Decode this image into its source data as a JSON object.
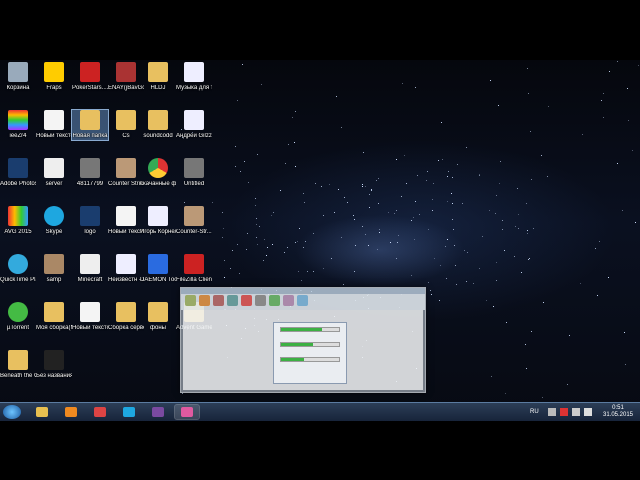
{
  "desktop": {
    "icons": [
      {
        "label": "Корзина",
        "icon": "recycle-bin-icon"
      },
      {
        "label": "Fraps",
        "icon": "fraps-icon"
      },
      {
        "label": "PokerStars....",
        "icon": "pokerstars-icon"
      },
      {
        "label": "ENAY(jBavGc",
        "icon": "archive-icon"
      },
      {
        "label": "HLDJ",
        "icon": "folder-icon"
      },
      {
        "label": "Музыка для тубр - Тру...",
        "icon": "audio-file-icon"
      },
      {
        "label": "ieeZr4",
        "icon": "rainbow-image-icon"
      },
      {
        "label": "Новый текстовый ...",
        "icon": "text-file-icon"
      },
      {
        "label": "Новая папка",
        "icon": "folder-icon"
      },
      {
        "label": "Cs",
        "icon": "folder-icon"
      },
      {
        "label": "soundcodd",
        "icon": "folder-icon"
      },
      {
        "label": "Андрей Gilzz-Lee ...",
        "icon": "audio-file-icon"
      },
      {
        "label": "Adobe Photosh...",
        "icon": "photoshop-icon"
      },
      {
        "label": "server",
        "icon": "file-icon"
      },
      {
        "label": "48117799",
        "icon": "image-file-icon"
      },
      {
        "label": "Counter Strike Sour...",
        "icon": "counter-strike-icon"
      },
      {
        "label": "скачанные файлы",
        "icon": "chrome-icon"
      },
      {
        "label": "Untitled",
        "icon": "image-file-icon"
      },
      {
        "label": "AVG 2015",
        "icon": "avg-icon"
      },
      {
        "label": "Skype",
        "icon": "skype-icon"
      },
      {
        "label": "logo",
        "icon": "photoshop-file-icon"
      },
      {
        "label": "Новый текстов...",
        "icon": "text-file-icon"
      },
      {
        "label": "Игорь Корнелю...",
        "icon": "audio-file-icon"
      },
      {
        "label": "Counter-Str... 1.6 Хром 1...",
        "icon": "counter-strike-icon"
      },
      {
        "label": "QuickTime Player",
        "icon": "quicktime-icon"
      },
      {
        "label": "samp",
        "icon": "gta-icon"
      },
      {
        "label": "Minecraft",
        "icon": "file-icon"
      },
      {
        "label": "Неизвестн - Взрыв это...",
        "icon": "audio-file-icon"
      },
      {
        "label": "DAEMON Tools Lite",
        "icon": "daemon-tools-icon"
      },
      {
        "label": "FileZilla Client",
        "icon": "filezilla-icon"
      },
      {
        "label": "µTorrent",
        "icon": "utorrent-icon"
      },
      {
        "label": "Моя сборка(Ml...",
        "icon": "folder-icon"
      },
      {
        "label": "Новый текстовый ...",
        "icon": "text-file-icon"
      },
      {
        "label": "Сборка сервер...",
        "icon": "folder-icon"
      },
      {
        "label": "фоны",
        "icon": "folder-icon"
      },
      {
        "label": "Advent Game c...",
        "icon": "folder-icon"
      },
      {
        "label": "Beneath the Cardboard",
        "icon": "folder-icon"
      },
      {
        "label": "Без названия",
        "icon": "video-file-icon"
      }
    ]
  },
  "taskbar": {
    "start_icon": "windows-start-icon",
    "items": [
      {
        "name": "explorer-icon",
        "color": "#e8c050"
      },
      {
        "name": "media-player-icon",
        "color": "#f08a20"
      },
      {
        "name": "chrome-icon",
        "color": "#d44"
      },
      {
        "name": "skype-icon",
        "color": "#1ea7e0"
      },
      {
        "name": "winrar-icon",
        "color": "#7a4aa0"
      },
      {
        "name": "paint-icon",
        "color": "#e05aa0"
      }
    ],
    "tray": {
      "language": "RU",
      "time": "0:51",
      "date": "31.05.2015"
    }
  }
}
